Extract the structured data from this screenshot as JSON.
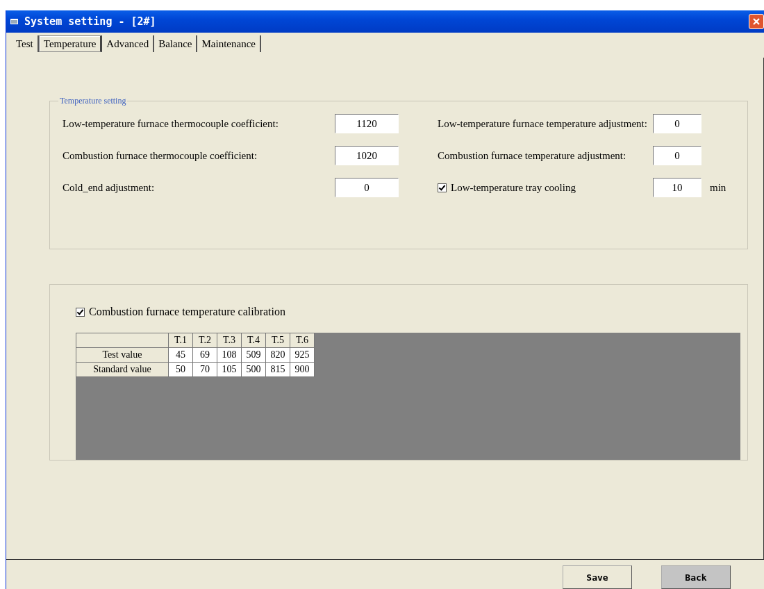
{
  "window": {
    "title": "System setting - [2#]"
  },
  "tabs": [
    {
      "label": "Test",
      "selected": false
    },
    {
      "label": "Temperature",
      "selected": true
    },
    {
      "label": "Advanced",
      "selected": false
    },
    {
      "label": "Balance",
      "selected": false
    },
    {
      "label": "Maintenance",
      "selected": false
    }
  ],
  "temperature_setting": {
    "title": "Temperature setting",
    "fields": [
      {
        "kind": "field",
        "label": "Low-temperature furnace thermocouple coefficient:",
        "value": "1120"
      },
      {
        "kind": "field",
        "label": "Low-temperature furnace temperature adjustment:",
        "value": "0"
      },
      {
        "kind": "field",
        "label": "Combustion furnace thermocouple coefficient:",
        "value": "1020"
      },
      {
        "kind": "field",
        "label": "Combustion furnace temperature adjustment:",
        "value": "0"
      },
      {
        "kind": "field",
        "label": "Cold_end adjustment:",
        "value": "0"
      },
      {
        "kind": "check",
        "label": "Low-temperature tray cooling",
        "checked": true,
        "value": "10",
        "unit": "min"
      }
    ]
  },
  "calibration": {
    "label": "Combustion furnace temperature calibration",
    "checked": true,
    "table": {
      "columns": [
        "T.1",
        "T.2",
        "T.3",
        "T.4",
        "T.5",
        "T.6"
      ],
      "rows": [
        {
          "name": "Test value",
          "cells": [
            "45",
            "69",
            "108",
            "509",
            "820",
            "925"
          ]
        },
        {
          "name": "Standard value",
          "cells": [
            "50",
            "70",
            "105",
            "500",
            "815",
            "900"
          ]
        }
      ]
    }
  },
  "buttons": [
    {
      "label": "Save",
      "highlighted": false
    },
    {
      "label": "Back",
      "highlighted": true
    }
  ]
}
